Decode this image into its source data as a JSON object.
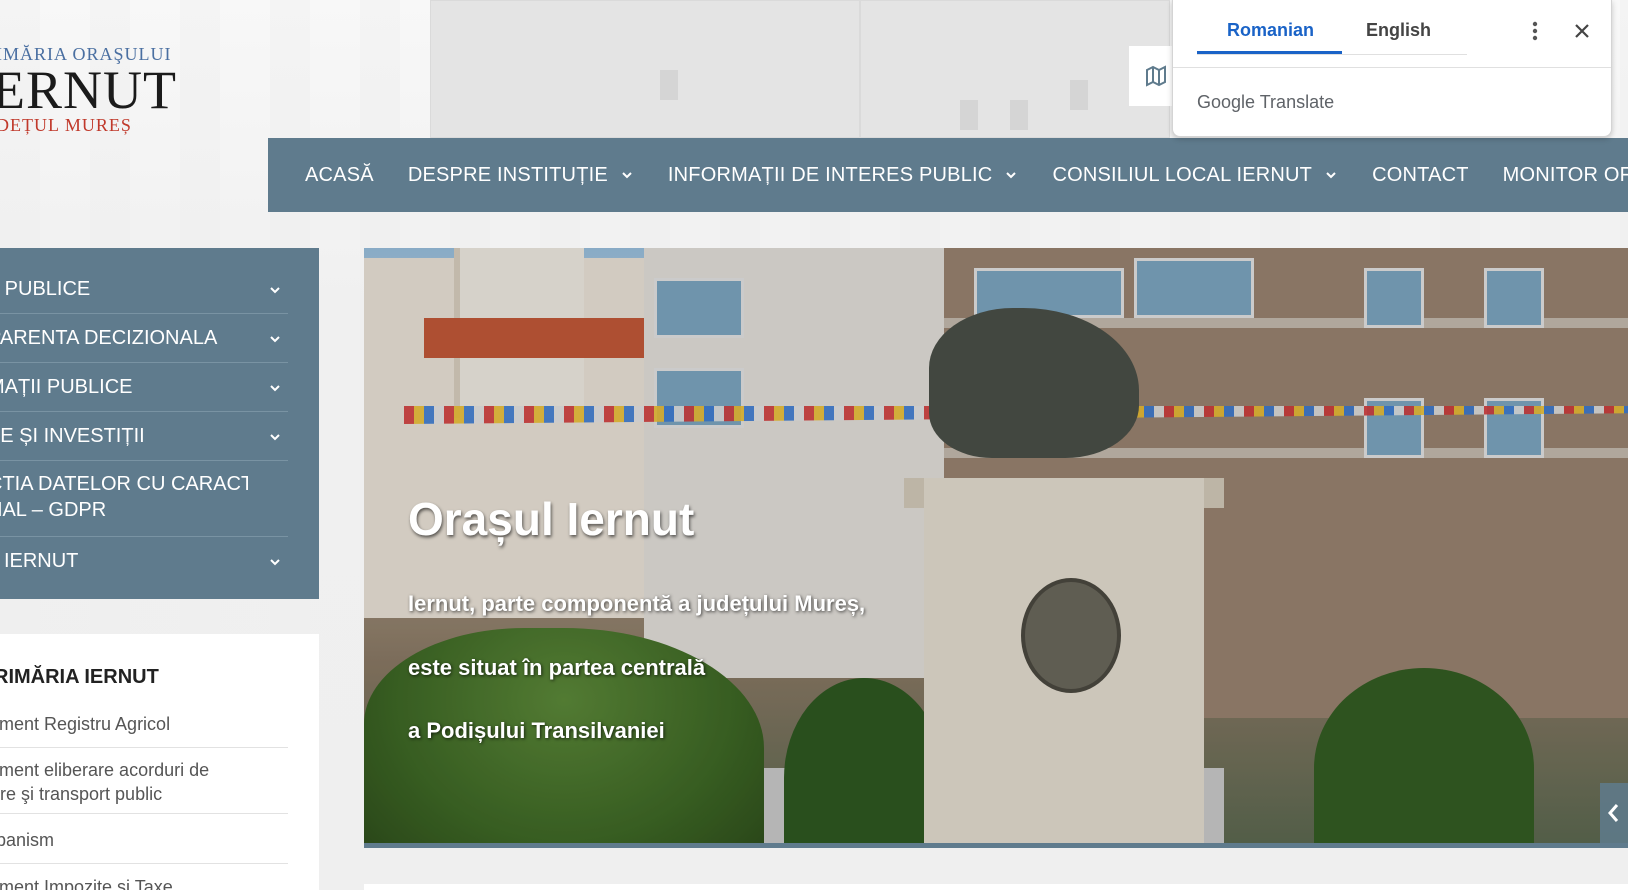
{
  "logo": {
    "line1": "IMĂRIA ORAŞULUI",
    "line2": "ERNUT",
    "line3": "DEȚUL MUREȘ"
  },
  "nav": {
    "items": [
      {
        "label": "ACASĂ",
        "has_dropdown": false
      },
      {
        "label": "DESPRE INSTITUȚIE",
        "has_dropdown": true
      },
      {
        "label": "INFORMAȚII DE INTERES PUBLIC",
        "has_dropdown": true
      },
      {
        "label": "CONSILIUL LOCAL IERNUT",
        "has_dropdown": true
      },
      {
        "label": "CONTACT",
        "has_dropdown": false
      },
      {
        "label": "MONITOR OFICIAL LOC",
        "has_dropdown": false
      }
    ]
  },
  "sidebar_menu": {
    "items": [
      {
        "label": "II PUBLICE"
      },
      {
        "label": "PARENTA DECIZIONALA"
      },
      {
        "label": "MAȚII PUBLICE"
      },
      {
        "label": "TE ȘI INVESTIȚII"
      },
      {
        "label_line1": "CTIA DATELOR CU CARACTER",
        "label_line2": "NAL – GDPR"
      },
      {
        "label": "L IERNUT"
      }
    ]
  },
  "widget": {
    "title": "RIMĂRIA IERNUT",
    "links": [
      {
        "label": "timent Registru Agricol"
      },
      {
        "line1": "timent eliberare acorduri de",
        "line2": "are şi transport public"
      },
      {
        "label": "rbanism"
      },
      {
        "label": "timent Impozite şi Taxe"
      }
    ]
  },
  "hero": {
    "title": "Orașul Iernut",
    "lines": [
      "Iernut, parte componentă a județului Mureș,",
      "este situat în partea centrală",
      "a Podișului Transilvaniei"
    ]
  },
  "translate_popup": {
    "tabs": [
      "Romanian",
      "English"
    ],
    "active_tab": "Romanian",
    "brand_google": "Google",
    "brand_translate": "Translate"
  },
  "colors": {
    "nav_bg": "#5f7b8d",
    "gt_accent": "#1a63c7"
  }
}
